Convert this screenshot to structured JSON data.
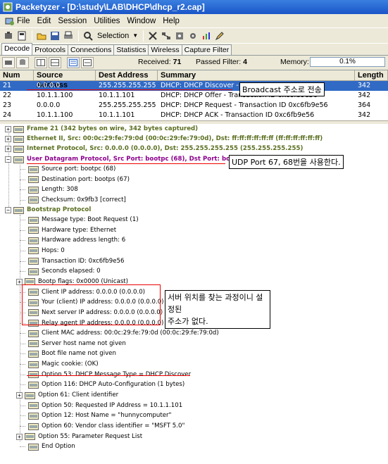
{
  "window": {
    "title": "Packetyzer - [D:\\study\\LAB\\DHCP\\dhcp_r2.cap]"
  },
  "menu": [
    "File",
    "Edit",
    "Session",
    "Utilities",
    "Window",
    "Help"
  ],
  "toolbar": {
    "selection_label": "Selection"
  },
  "tabs": [
    "Decode",
    "Protocols",
    "Connections",
    "Statistics",
    "Wireless",
    "Capture Filter"
  ],
  "status": {
    "received_label": "Received:",
    "received_value": "71",
    "filter_label": "Passed Filter:",
    "filter_value": "4",
    "memory_label": "Memory:",
    "memory_value": "0.1%"
  },
  "packet_list": {
    "columns": [
      "Num",
      "Source Address",
      "Dest Address",
      "Summary",
      "Length"
    ],
    "rows": [
      {
        "num": "21",
        "src": "0.0.0.0",
        "dst": "255.255.255.255",
        "summary": "DHCP: DHCP Discover - T",
        "len": "342"
      },
      {
        "num": "22",
        "src": "10.1.1.100",
        "dst": "10.1.1.101",
        "summary": "DHCP: DHCP Offer   - Transaction ID 0xc6fb9e56",
        "len": "342"
      },
      {
        "num": "23",
        "src": "0.0.0.0",
        "dst": "255.255.255.255",
        "summary": "DHCP: DHCP Request  - Transaction ID 0xc6fb9e56",
        "len": "364"
      },
      {
        "num": "24",
        "src": "10.1.1.100",
        "dst": "10.1.1.101",
        "summary": "DHCP: DHCP ACK    - Transaction ID 0xc6fb9e56",
        "len": "342"
      }
    ]
  },
  "tree": {
    "frame": "Frame 21 (342 bytes on wire, 342 bytes captured)",
    "ethernet": "Ethernet II, Src: 00:0c:29:fe:79:0d (00:0c:29:fe:79:0d), Dst: ff:ff:ff:ff:ff:ff (ff:ff:ff:ff:ff:ff)",
    "ip": "Internet Protocol, Src: 0.0.0.0 (0.0.0.0), Dst: 255.255.255.255 (255.255.255.255)",
    "udp": "User Datagram Protocol, Src Port: bootpc (68), Dst Port: bootps (67)",
    "udp_fields": [
      "Source port: bootpc (68)",
      "Destination port: bootps (67)",
      "Length: 308",
      "Checksum: 0x9fb3 [correct]"
    ],
    "bootp": "Bootstrap Protocol",
    "bootp_fields": [
      "Message type: Boot Request (1)",
      "Hardware type: Ethernet",
      "Hardware address length: 6",
      "Hops: 0",
      "Transaction ID: 0xc6fb9e56",
      "Seconds elapsed: 0",
      "Bootp flags: 0x0000 (Unicast)",
      "Client IP address: 0.0.0.0 (0.0.0.0)",
      "Your (client) IP address: 0.0.0.0 (0.0.0.0)",
      "Next server IP address: 0.0.0.0 (0.0.0.0)",
      "Relay agent IP address: 0.0.0.0 (0.0.0.0)",
      "Client MAC address: 00:0c:29:fe:79:0d (00:0c:29:fe:79:0d)",
      "Server host name not given",
      "Boot file name not given",
      "Magic cookie: (OK)",
      "Option 53: DHCP Message Type = DHCP Discover",
      "Option 116: DHCP Auto-Configuration (1 bytes)",
      "Option 61: Client identifier",
      "Option 50: Requested IP Address = 10.1.1.101",
      "Option 12: Host Name = \"hunnycomputer\"",
      "Option 60: Vendor class identifier = \"MSFT 5.0\"",
      "Option 55: Parameter Request List",
      "End Option"
    ]
  },
  "annotations": {
    "broadcast": "Broadcast 주소로 전송",
    "udp_port": "UDP Port 67, 68번을 사용한다.",
    "server_line1": "서버 위치를 찾는 과정이니 설정된",
    "server_line2": "주소가 없다."
  },
  "colors": {
    "title_bar": "#1a55c8",
    "selection": "#316ac5",
    "proto_green": "#5a6e1f",
    "proto_udp": "#8b008b",
    "annotation_red": "#e00000"
  }
}
